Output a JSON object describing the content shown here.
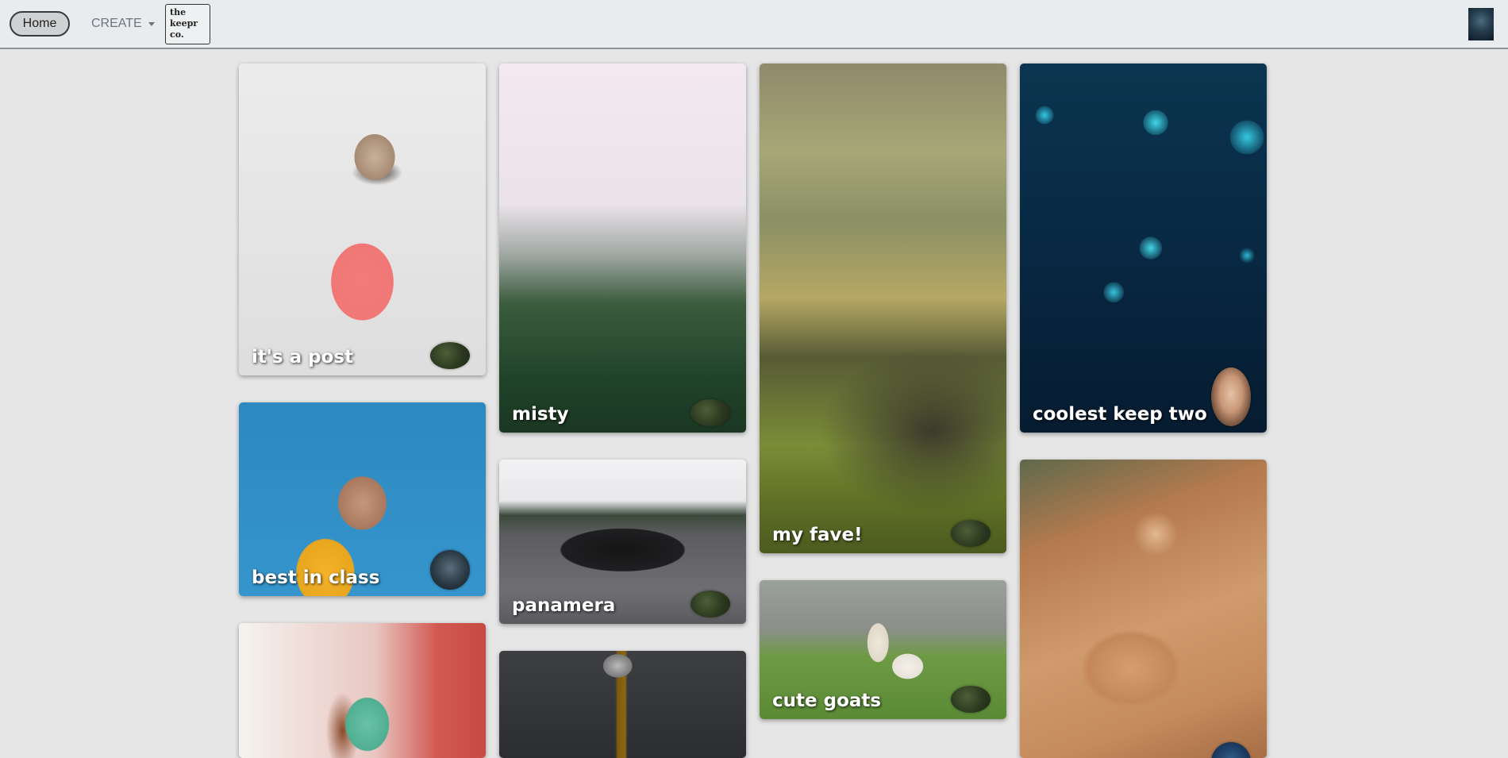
{
  "navbar": {
    "home_label": "Home",
    "create_label": "CREATE",
    "logo_lines": [
      "the",
      "keepr",
      "co."
    ]
  },
  "keeps": [
    {
      "title": "it's a post",
      "creator_avatar": "moss-avatar"
    },
    {
      "title": "best in class",
      "creator_avatar": "man-avatar"
    },
    {
      "title": "",
      "creator_avatar": ""
    },
    {
      "title": "misty",
      "creator_avatar": "moss-avatar"
    },
    {
      "title": "panamera",
      "creator_avatar": "moss-avatar"
    },
    {
      "title": "",
      "creator_avatar": ""
    },
    {
      "title": "my fave!",
      "creator_avatar": "moss-avatar"
    },
    {
      "title": "cute goats",
      "creator_avatar": "moss-avatar"
    },
    {
      "title": "coolest keep two",
      "creator_avatar": "woman-avatar"
    },
    {
      "title": "",
      "creator_avatar": "blue-avatar"
    }
  ]
}
